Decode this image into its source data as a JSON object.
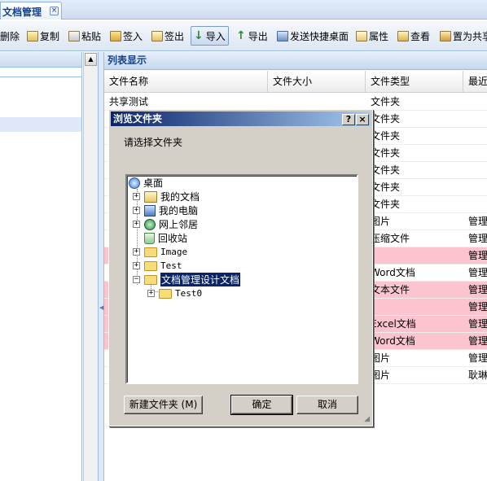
{
  "tab": {
    "title": "文档管理",
    "close": "×"
  },
  "toolbar": {
    "delete": "删除",
    "copy": "复制",
    "paste": "粘贴",
    "checkin": "签入",
    "checkout": "签出",
    "import": "导入",
    "export": "导出",
    "send_shortcut": "发送快捷桌面",
    "properties": "属性",
    "view": "查看",
    "set_share": "置为共享"
  },
  "list": {
    "title": "列表显示",
    "columns": [
      "文件名称",
      "文件大小",
      "文件类型",
      "最近"
    ],
    "rows": [
      {
        "name": "共享测试",
        "size": "",
        "type": "文件夹",
        "last": "",
        "pink": false
      },
      {
        "name": "",
        "size": "",
        "type": "文件夹",
        "last": "",
        "pink": false
      },
      {
        "name": "",
        "size": "",
        "type": "文件夹",
        "last": "",
        "pink": false
      },
      {
        "name": "",
        "size": "",
        "type": "文件夹",
        "last": "",
        "pink": false
      },
      {
        "name": "",
        "size": "",
        "type": "文件夹",
        "last": "",
        "pink": false
      },
      {
        "name": "",
        "size": "",
        "type": "文件夹",
        "last": "",
        "pink": false
      },
      {
        "name": "",
        "size": "",
        "type": "文件夹",
        "last": "",
        "pink": false
      },
      {
        "name": "",
        "size": "",
        "type": "图片",
        "last": "管理",
        "pink": false
      },
      {
        "name": "",
        "size": "",
        "type": "压缩文件",
        "last": "管理",
        "pink": false
      },
      {
        "name": "",
        "size": "",
        "type": "",
        "last": "管理",
        "pink": true
      },
      {
        "name": "",
        "size": "",
        "type": "Word文档",
        "last": "管理",
        "pink": false
      },
      {
        "name": "",
        "size": "",
        "type": "文本文件",
        "last": "管理",
        "pink": true
      },
      {
        "name": "",
        "size": "",
        "type": "",
        "last": "管理",
        "pink": true
      },
      {
        "name": "",
        "size": "",
        "type": "Excel文档",
        "last": "管理",
        "pink": true
      },
      {
        "name": "",
        "size": "",
        "type": "Word文档",
        "last": "管理",
        "pink": true
      },
      {
        "name": "",
        "size": "",
        "type": "图片",
        "last": "管理",
        "pink": false
      },
      {
        "name": "",
        "size": "",
        "type": "图片",
        "last": "耿琳",
        "pink": false
      }
    ]
  },
  "dialog": {
    "title": "浏览文件夹",
    "help": "?",
    "close": "×",
    "prompt": "请选择文件夹",
    "tree": {
      "desktop": "桌面",
      "my_docs": "我的文档",
      "my_pc": "我的电脑",
      "network": "网上邻居",
      "recycle": "回收站",
      "image": "Image",
      "test": "Test",
      "design_docs": "文档管理设计文档",
      "test0": "Test0"
    },
    "expand_plus": "+",
    "expand_minus": "−",
    "new_folder": "新建文件夹 (M)",
    "ok": "确定",
    "cancel": "取消"
  }
}
